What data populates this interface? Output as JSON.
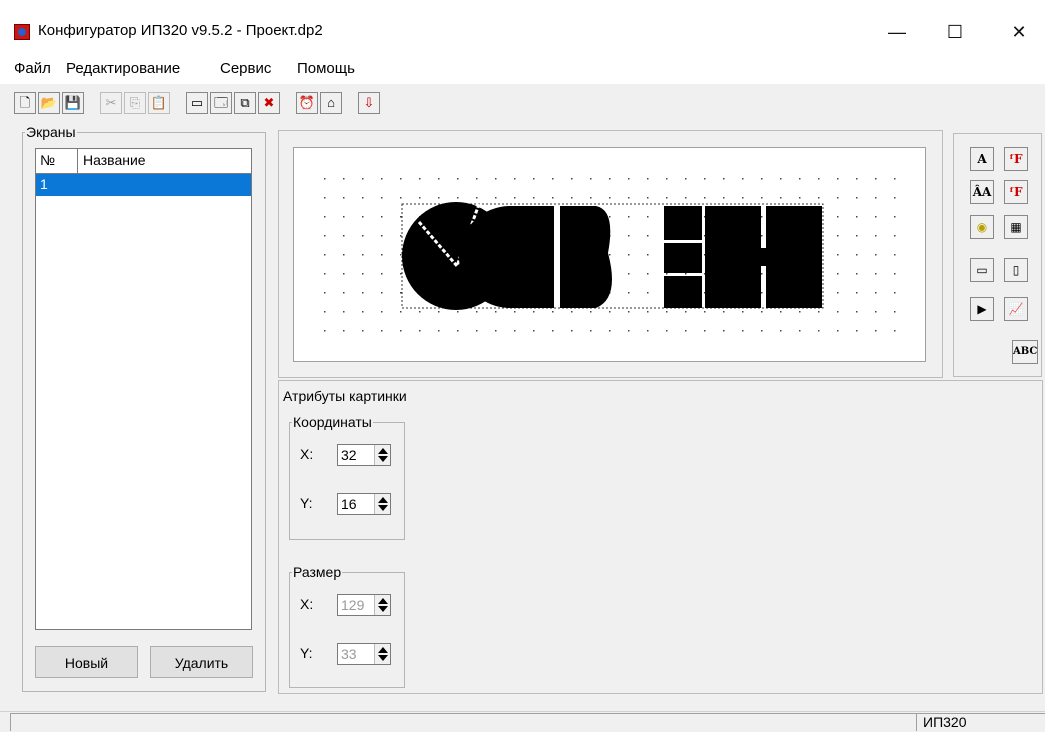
{
  "window": {
    "title": "Конфигуратор ИП320 v9.5.2 - Проект.dp2",
    "minimize": "—",
    "maximize": "☐",
    "close": "✕"
  },
  "menu": [
    "Файл",
    "Редактирование",
    "Сервис",
    "Помощь"
  ],
  "toolbar": {
    "buttons": [
      {
        "name": "new-file-icon",
        "glyph": "🗋"
      },
      {
        "name": "open-folder-icon",
        "glyph": "📂"
      },
      {
        "name": "save-icon",
        "glyph": "💾"
      },
      {
        "name": "cut-icon",
        "glyph": "✂"
      },
      {
        "name": "copy-icon",
        "glyph": "⎘"
      },
      {
        "name": "paste-icon",
        "glyph": "📋"
      },
      {
        "name": "screen-add-icon",
        "glyph": "▭"
      },
      {
        "name": "screen-props-icon",
        "glyph": "🗔"
      },
      {
        "name": "screen-copy-icon",
        "glyph": "⧉"
      },
      {
        "name": "screen-delete-icon",
        "glyph": "✖"
      },
      {
        "name": "alarm-icon",
        "glyph": "⏰"
      },
      {
        "name": "home-icon",
        "glyph": "⌂"
      },
      {
        "name": "download-device-icon",
        "glyph": "⇩"
      }
    ]
  },
  "screens": {
    "legend": "Экраны",
    "col_num": "№",
    "col_name": "Название",
    "rows": [
      {
        "num": "1",
        "name": ""
      }
    ],
    "new_button": "Новый",
    "delete_button": "Удалить"
  },
  "tools": {
    "text": "A",
    "font": "ᶠF",
    "font_resize": "ÂA",
    "font_color": "ᶠF",
    "button": "◉",
    "dots": "▦",
    "indicator": "▭",
    "bar": "▯",
    "play": "▶",
    "graph": "📈",
    "abc": "ABC"
  },
  "attributes": {
    "legend": "Атрибуты картинки",
    "coords_legend": "Координаты",
    "size_legend": "Размер",
    "x_label": "X:",
    "y_label": "Y:",
    "coord_x": "32",
    "coord_y": "16",
    "size_x": "129",
    "size_y": "33"
  },
  "status": {
    "device": "ИП320"
  }
}
